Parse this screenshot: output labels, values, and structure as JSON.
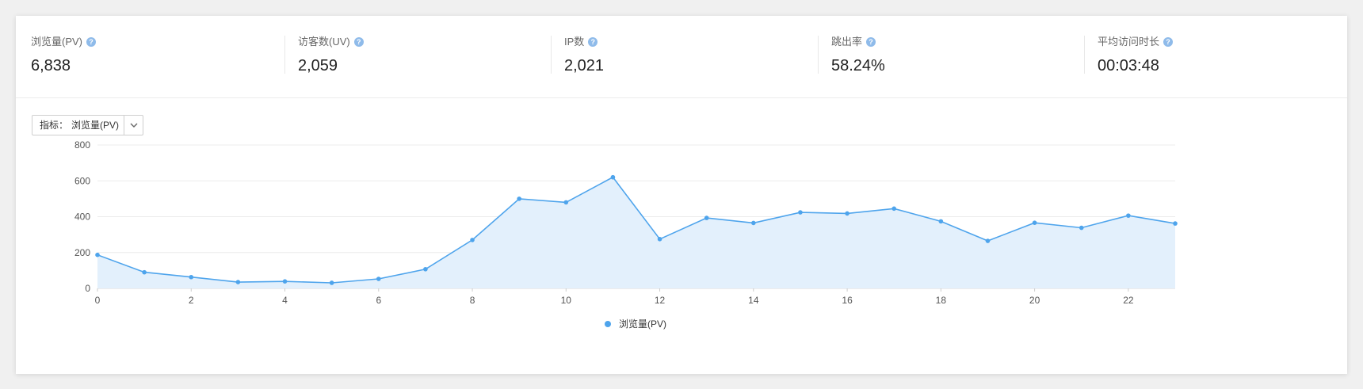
{
  "metrics": [
    {
      "label": "浏览量(PV)",
      "value": "6,838"
    },
    {
      "label": "访客数(UV)",
      "value": "2,059"
    },
    {
      "label": "IP数",
      "value": "2,021"
    },
    {
      "label": "跳出率",
      "value": "58.24%"
    },
    {
      "label": "平均访问时长",
      "value": "00:03:48"
    }
  ],
  "help_icon": "question-mark-icon",
  "selector": {
    "label": "指标：",
    "value": "浏览量(PV)",
    "icon": "chevron-down-icon"
  },
  "colors": {
    "line": "#4ea4ec",
    "area": "#e3f0fc",
    "grid": "#ececec"
  },
  "chart_data": {
    "type": "area",
    "x": [
      0,
      1,
      2,
      3,
      4,
      5,
      6,
      7,
      8,
      9,
      10,
      11,
      12,
      13,
      14,
      15,
      16,
      17,
      18,
      19,
      20,
      21,
      22,
      23
    ],
    "x_ticks": [
      "0",
      "2",
      "4",
      "6",
      "8",
      "10",
      "12",
      "14",
      "16",
      "18",
      "20",
      "22"
    ],
    "y_ticks": [
      "0",
      "200",
      "400",
      "600",
      "800"
    ],
    "ylim": [
      0,
      800
    ],
    "series": [
      {
        "name": "浏览量(PV)",
        "values": [
          187,
          90,
          63,
          35,
          39,
          31,
          53,
          107,
          270,
          500,
          480,
          620,
          275,
          393,
          365,
          424,
          418,
          445,
          374,
          265,
          366,
          338,
          406,
          362
        ]
      }
    ],
    "legend_position": "bottom-center",
    "grid": true
  }
}
